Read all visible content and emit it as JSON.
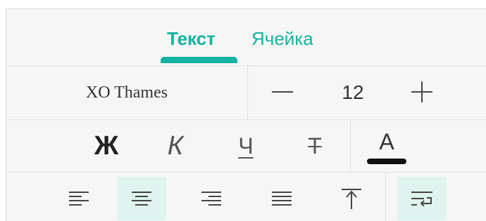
{
  "tabs": [
    {
      "label": "Текст",
      "active": true
    },
    {
      "label": "Ячейка",
      "active": false
    }
  ],
  "font": {
    "name": "XO Thames",
    "size": "12",
    "decrease_icon": "minus-icon",
    "increase_icon": "plus-icon"
  },
  "style": {
    "bold": "Ж",
    "italic": "К",
    "underline": "Ч",
    "strikethrough": "Т",
    "color_letter": "А",
    "color_swatch": "#111111"
  },
  "alignment": {
    "buttons": [
      {
        "name": "align-left-icon",
        "selected": false
      },
      {
        "name": "align-center-icon",
        "selected": true
      },
      {
        "name": "align-right-icon",
        "selected": false
      },
      {
        "name": "align-justify-icon",
        "selected": false
      },
      {
        "name": "align-top-icon",
        "selected": false
      },
      {
        "name": "wrap-text-icon",
        "selected": true
      }
    ]
  },
  "colors": {
    "accent": "#14b3a1",
    "selected_bg": "#dff4ee"
  }
}
